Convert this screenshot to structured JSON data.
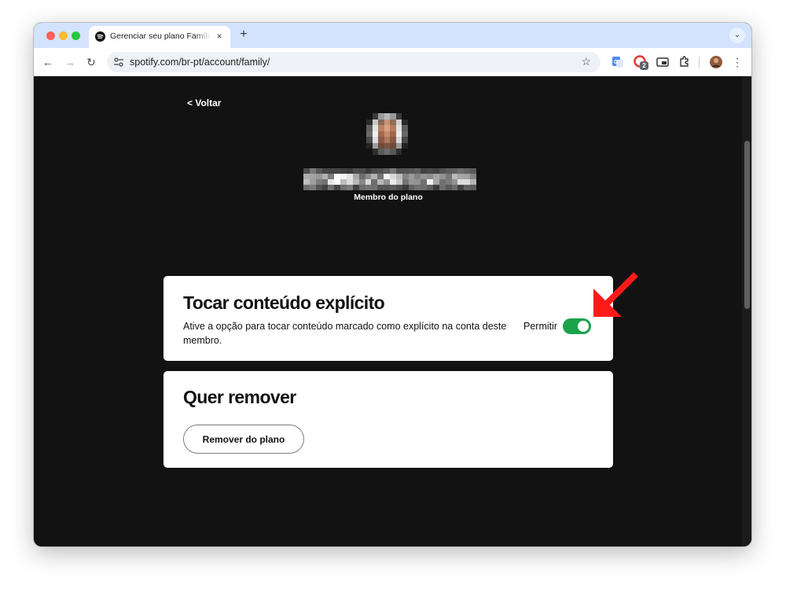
{
  "browser": {
    "tab_title": "Gerenciar seu plano Família -",
    "close_tab_glyph": "×",
    "new_tab_glyph": "+",
    "tab_search_glyph": "⌄",
    "back_glyph": "←",
    "forward_glyph": "→",
    "reload_glyph": "↻",
    "star_glyph": "☆",
    "menu_glyph": "⋮",
    "url": "spotify.com/br-pt/account/family/",
    "extension_badge": "2"
  },
  "page": {
    "back_label": "< Voltar",
    "member_role": "Membro do plano"
  },
  "explicit_card": {
    "title": "Tocar conteúdo explícito",
    "description": "Ative a opção para tocar conteúdo marcado como explícito na conta deste membro.",
    "toggle_label": "Permitir",
    "toggle_on": true
  },
  "remove_card": {
    "title": "Quer remover",
    "button_label": "Remover do plano"
  },
  "colors": {
    "background": "#121212",
    "card": "#ffffff",
    "toggle_on": "#1ba24b",
    "annotation_arrow": "#ff1a1a",
    "tabstrip": "#d3e3fd"
  },
  "icons": {
    "favicon": "spotify-icon",
    "site_info": "tune-icon",
    "translate": "translate-icon",
    "extension": "extension-badge-icon",
    "pip": "picture-in-picture-icon",
    "puzzle": "extensions-puzzle-icon",
    "profile": "profile-avatar-icon"
  }
}
